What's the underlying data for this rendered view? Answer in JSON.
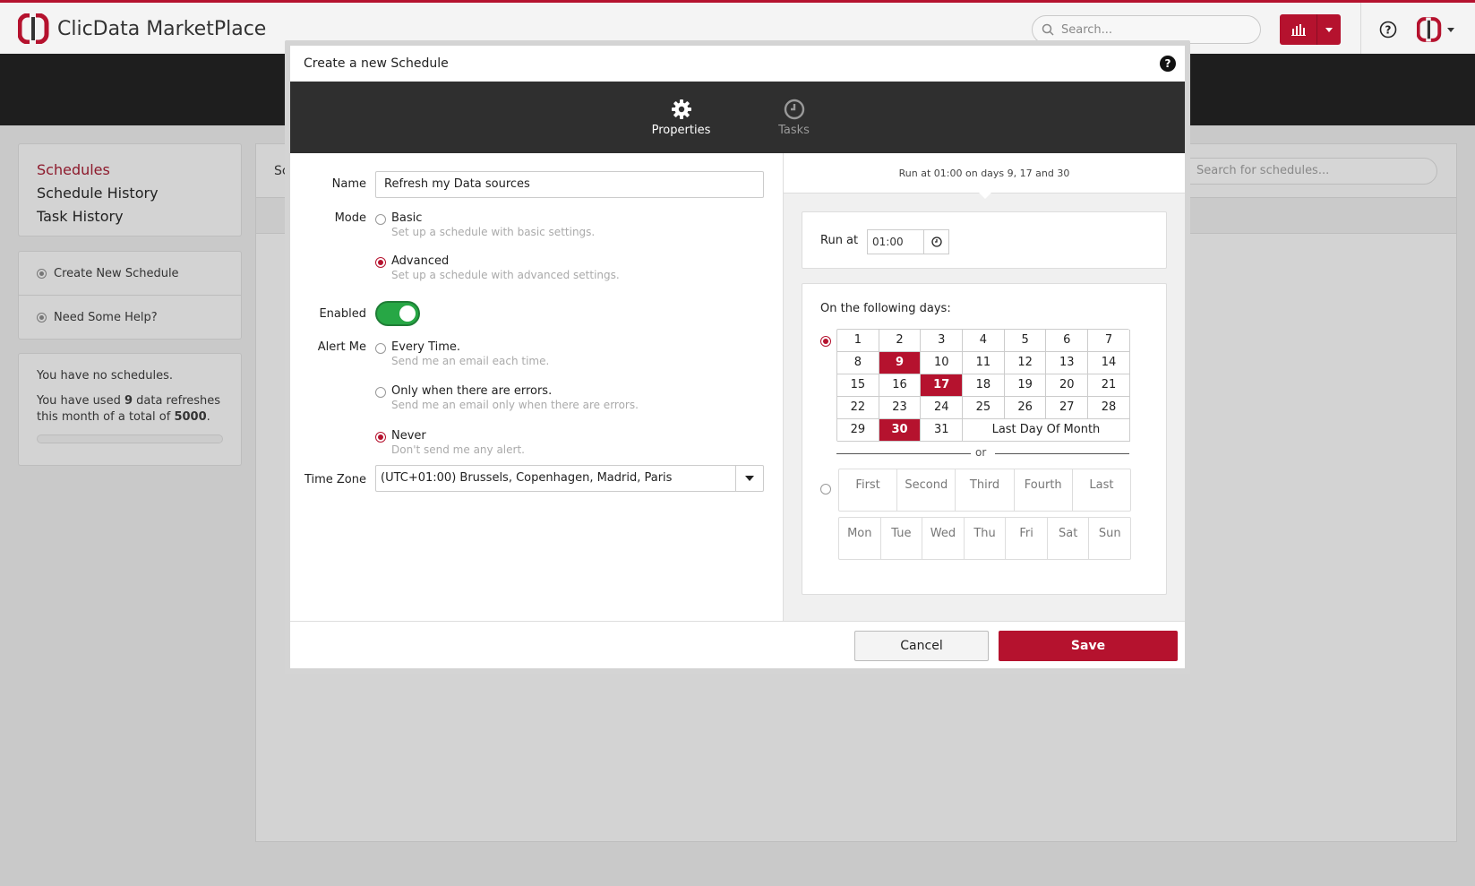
{
  "app": {
    "brand": "ClicData MarketPlace",
    "search_placeholder": "Search...",
    "accent": "#b5122e"
  },
  "sidebar": {
    "nav": [
      "Schedules",
      "Schedule History",
      "Task History"
    ],
    "actions": [
      "Create New Schedule",
      "Need Some Help?"
    ],
    "info": {
      "no_schedules": "You have no schedules.",
      "usage_prefix": "You have used ",
      "used": "9",
      "usage_mid": " data refreshes this month of a total of ",
      "total": "5000",
      "usage_suffix": "."
    }
  },
  "main": {
    "header_partial": "Sc",
    "search_placeholder": "Search for schedules..."
  },
  "modal": {
    "title": "Create a new Schedule",
    "help": "?",
    "tabs": [
      {
        "label": "Properties",
        "icon": "gear-icon",
        "active": true
      },
      {
        "label": "Tasks",
        "icon": "clock-icon",
        "active": false
      }
    ],
    "form": {
      "name_label": "Name",
      "name_value": "Refresh my Data sources",
      "mode_label": "Mode",
      "mode_options": [
        {
          "title": "Basic",
          "desc": "Set up a schedule with basic settings.",
          "selected": false
        },
        {
          "title": "Advanced",
          "desc": "Set up a schedule with advanced settings.",
          "selected": true
        }
      ],
      "enabled_label": "Enabled",
      "enabled": true,
      "alert_label": "Alert Me",
      "alert_options": [
        {
          "title": "Every Time.",
          "desc": "Send me an email each time.",
          "selected": false
        },
        {
          "title": "Only when there are errors.",
          "desc": "Send me an email only when there are errors.",
          "selected": false
        },
        {
          "title": "Never",
          "desc": "Don't send me any alert.",
          "selected": true
        }
      ],
      "timezone_label": "Time Zone",
      "timezone_value": "(UTC+01:00) Brussels, Copenhagen, Madrid, Paris"
    },
    "schedule": {
      "summary": "Run at 01:00 on days 9, 17 and 30",
      "run_at_label": "Run at",
      "run_at_value": "01:00",
      "days_label": "On the following days:",
      "days": [
        "1",
        "2",
        "3",
        "4",
        "5",
        "6",
        "7",
        "8",
        "9",
        "10",
        "11",
        "12",
        "13",
        "14",
        "15",
        "16",
        "17",
        "18",
        "19",
        "20",
        "21",
        "22",
        "23",
        "24",
        "25",
        "26",
        "27",
        "28",
        "29",
        "30",
        "31"
      ],
      "selected_days": [
        "9",
        "17",
        "30"
      ],
      "last_day_label": "Last Day Of Month",
      "or_label": "or",
      "ordinals": [
        "First",
        "Second",
        "Third",
        "Fourth",
        "Last"
      ],
      "weekdays": [
        "Mon",
        "Tue",
        "Wed",
        "Thu",
        "Fri",
        "Sat",
        "Sun"
      ]
    },
    "buttons": {
      "cancel": "Cancel",
      "save": "Save"
    }
  }
}
